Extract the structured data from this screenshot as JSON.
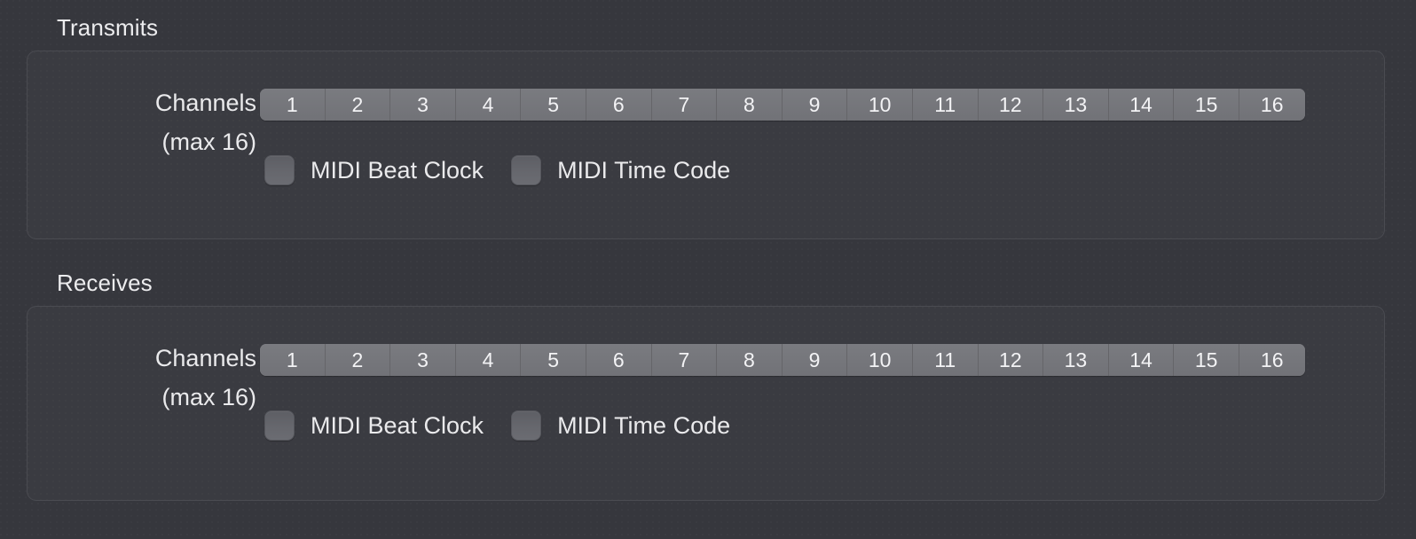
{
  "sections": [
    {
      "title": "Transmits",
      "channels": {
        "label_line1": "Channels",
        "label_line2": "(max 16)",
        "segments": [
          "1",
          "2",
          "3",
          "4",
          "5",
          "6",
          "7",
          "8",
          "9",
          "10",
          "11",
          "12",
          "13",
          "14",
          "15",
          "16"
        ]
      },
      "checkboxes": [
        {
          "label": "MIDI Beat Clock",
          "checked": false
        },
        {
          "label": "MIDI Time Code",
          "checked": false
        }
      ]
    },
    {
      "title": "Receives",
      "channels": {
        "label_line1": "Channels",
        "label_line2": "(max 16)",
        "segments": [
          "1",
          "2",
          "3",
          "4",
          "5",
          "6",
          "7",
          "8",
          "9",
          "10",
          "11",
          "12",
          "13",
          "14",
          "15",
          "16"
        ]
      },
      "checkboxes": [
        {
          "label": "MIDI Beat Clock",
          "checked": false
        },
        {
          "label": "MIDI Time Code",
          "checked": false
        }
      ]
    }
  ],
  "colors": {
    "background": "#36373d",
    "group_fill": "#3a3b41",
    "group_border": "#4a4b51",
    "segment_fill": "#74757a",
    "segment_divider": "#656569",
    "text": "#eaeaec",
    "checkbox_fill": "#66676d"
  }
}
